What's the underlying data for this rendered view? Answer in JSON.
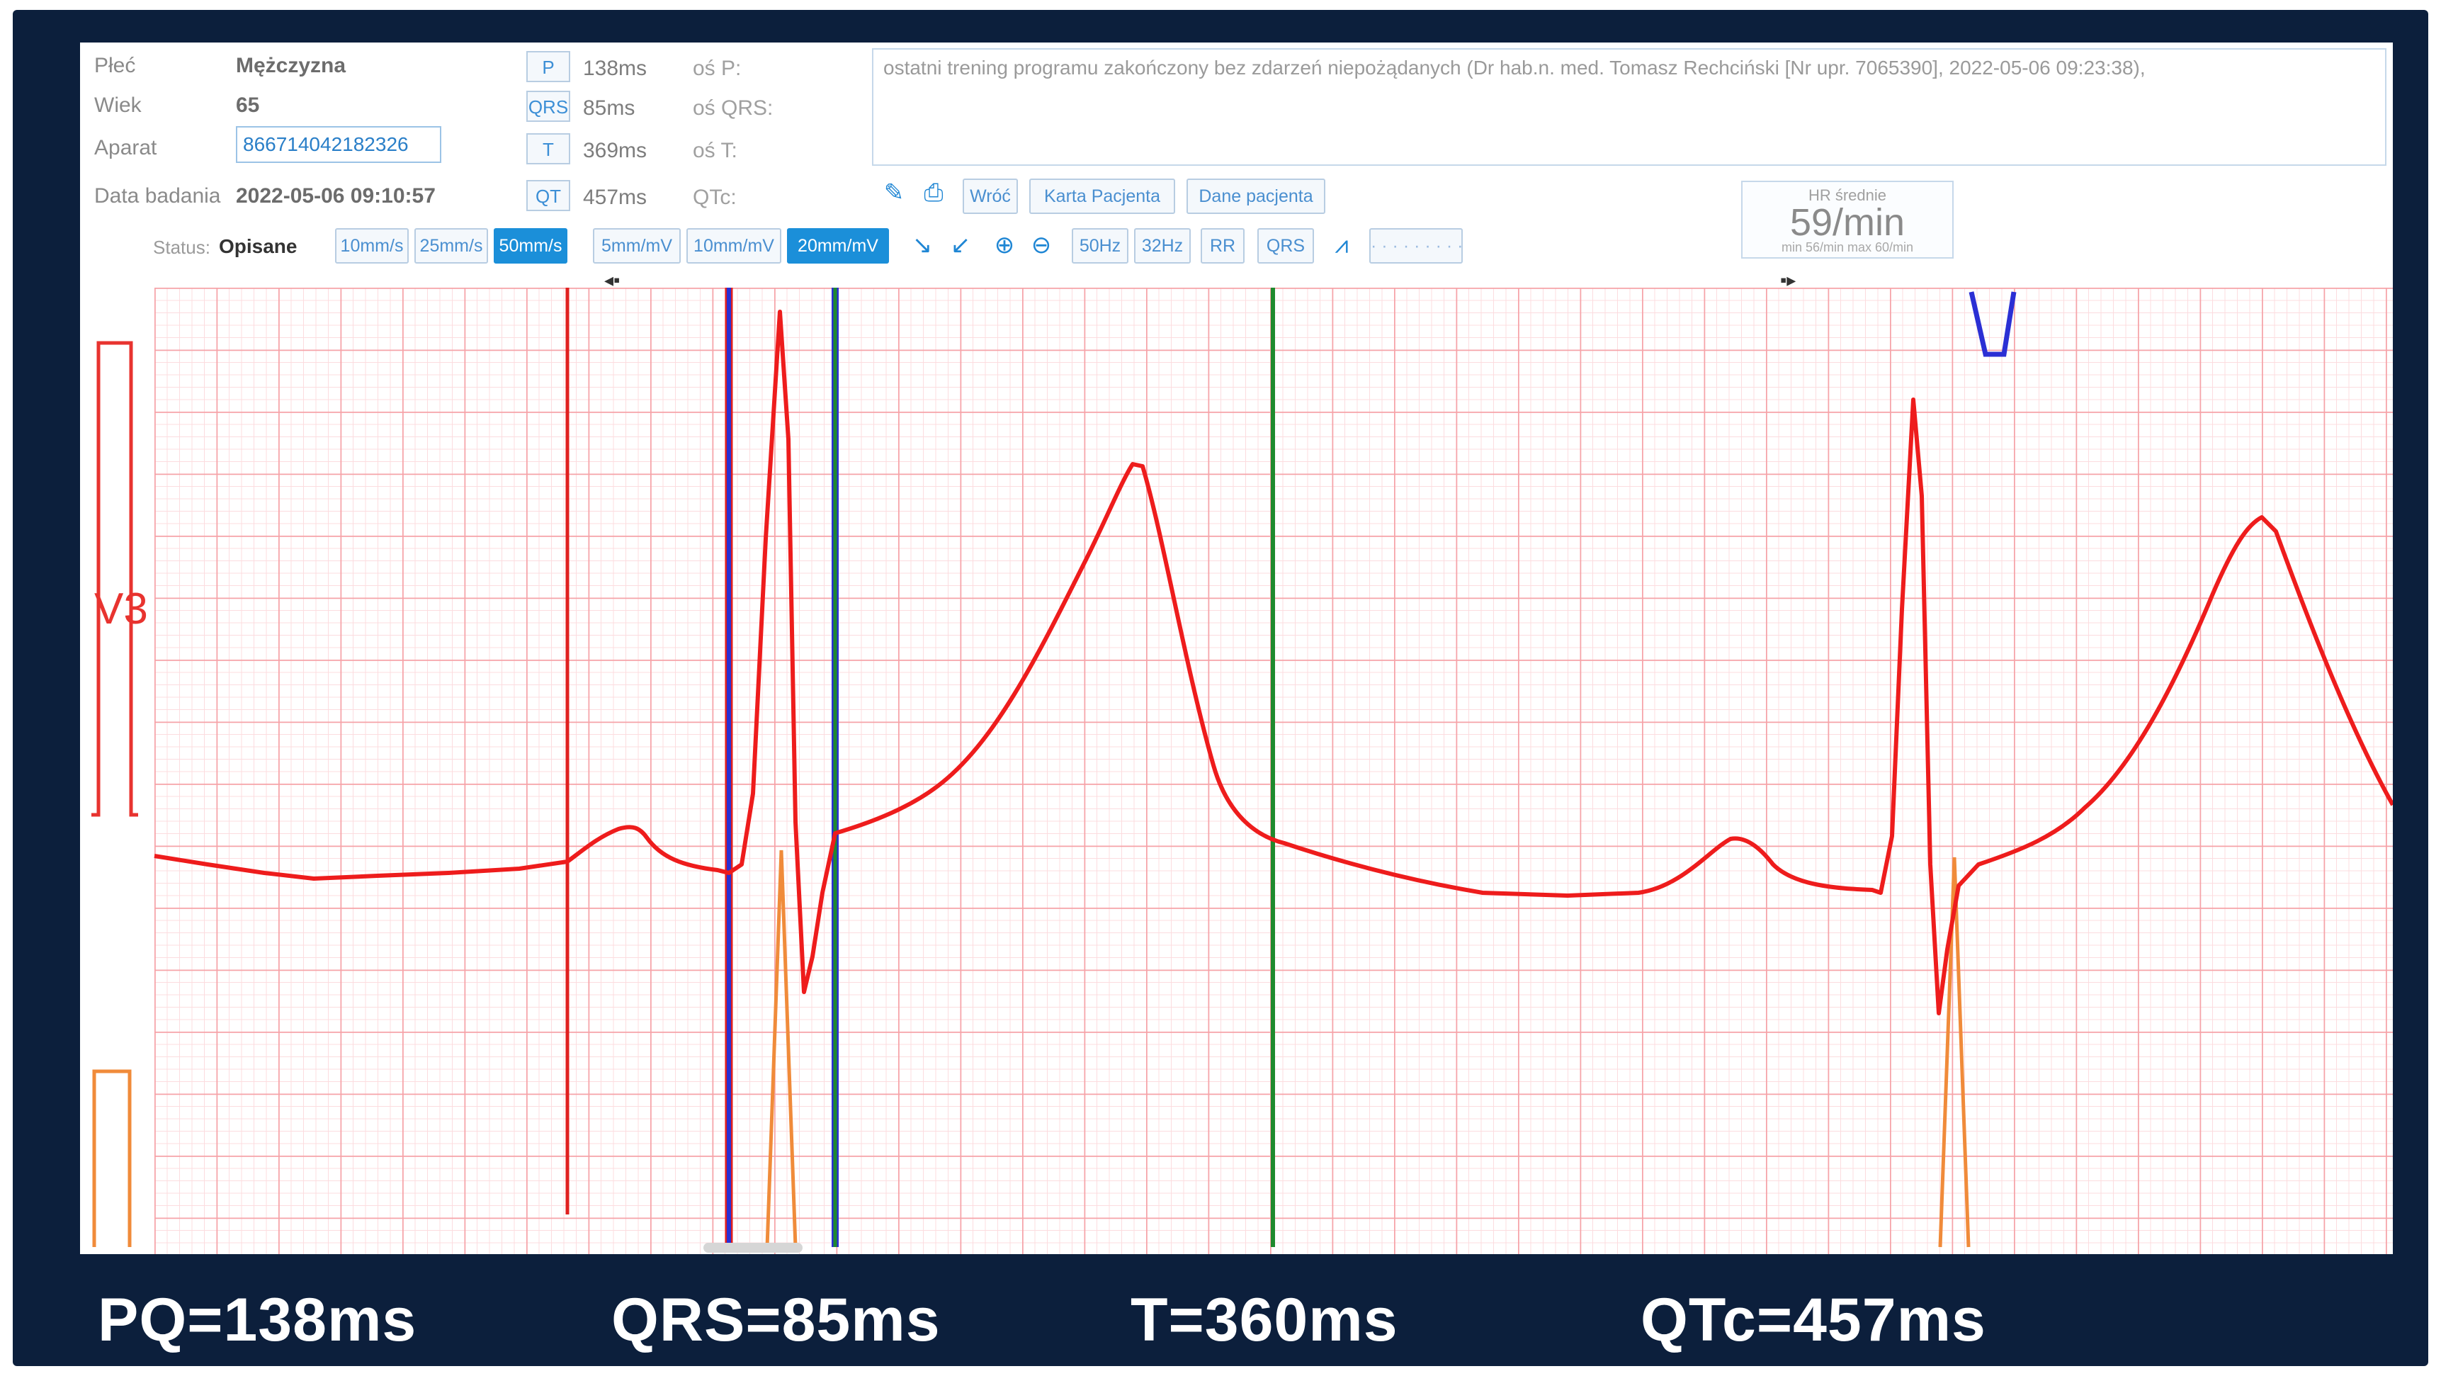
{
  "patient": {
    "sex_label": "Płeć",
    "sex_value": "Mężczyzna",
    "age_label": "Wiek",
    "age_value": "65",
    "device_label": "Aparat",
    "device_value": "8667140421823​26",
    "date_label": "Data badania",
    "date_value": "2022-05-06 09:10:57"
  },
  "metrics": {
    "p_badge": "P",
    "p_value": "138ms",
    "p_axis": "oś P:",
    "qrs_badge": "QRS",
    "qrs_value": "85ms",
    "qrs_axis": "oś QRS:",
    "t_badge": "T",
    "t_value": "369ms",
    "t_axis": "oś T:",
    "qt_badge": "QT",
    "qt_value": "457ms",
    "qtc_label": "QTc:"
  },
  "note": "ostatni trening programu zakończony bez zdarzeń niepożądanych (Dr hab.n. med. Tomasz Rechciński [Nr upr. 7065390], 2022-05-06 09:23:38),",
  "actions": {
    "back": "Wróć",
    "patient_card": "Karta Pacjenta",
    "patient_data": "Dane pacjenta"
  },
  "hr": {
    "title": "HR średnie",
    "value": "59/min",
    "range": "min 56/min max 60/min"
  },
  "status": {
    "label": "Status:",
    "value": "Opisane"
  },
  "toolbar": {
    "speed_10": "10mm/s",
    "speed_25": "25mm/s",
    "speed_50": "50mm/s",
    "gain_5": "5mm/mV",
    "gain_10": "10mm/mV",
    "gain_20": "20mm/mV",
    "filter_50": "50Hz",
    "filter_32": "32Hz",
    "rr": "RR",
    "qrs": "QRS",
    "dots": "· · · · · · · · ·"
  },
  "lead": {
    "name": "V3"
  },
  "measurements": {
    "pq": "PQ=138ms",
    "qrs": "QRS=85ms",
    "t": "T=360ms",
    "qtc": "QTc=457ms"
  },
  "colors": {
    "frame": "#0c1f3c",
    "trace": "#ee1c1c",
    "grid_major": "#f6a3a8",
    "grid_minor": "#fcdcdf",
    "marker_red": "#e0201f",
    "marker_blue": "#2b2fd4",
    "marker_green": "#1f8a2e",
    "marker_orange": "#f08b3a"
  }
}
